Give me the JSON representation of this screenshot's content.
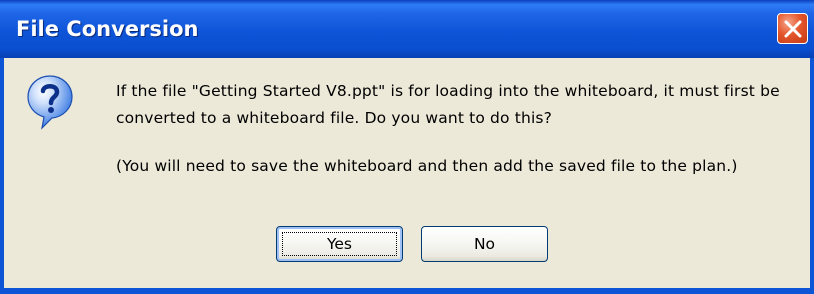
{
  "window": {
    "title": "File Conversion",
    "close_icon": "close-icon"
  },
  "dialog": {
    "icon": "question-icon",
    "message_line1": "If the file \"Getting Started V8.ppt\" is for loading into the whiteboard, it must first be converted to a whiteboard file. Do you want to do this?",
    "message_line2": "(You will need to save the whiteboard and then add the saved file to the plan.)"
  },
  "buttons": {
    "yes_label": "Yes",
    "no_label": "No"
  },
  "colors": {
    "titlebar": "#0d54d8",
    "close_button": "#e4562c",
    "dialog_bg": "#ece9d8",
    "icon_blue": "#2a6fe0"
  }
}
